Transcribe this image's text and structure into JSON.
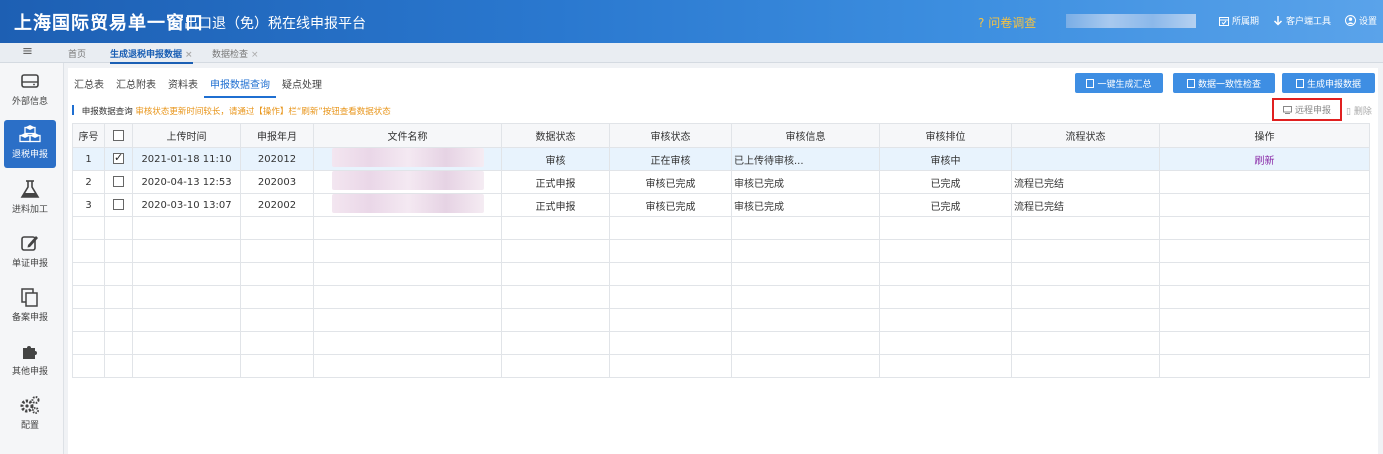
{
  "header": {
    "brand": "上海国际贸易单一窗口",
    "subtitle": "出口退（免）税在线申报平台",
    "survey": "问卷调查",
    "actions": [
      {
        "label": "所属期",
        "icon": "calendar-icon"
      },
      {
        "label": "客户端工具",
        "icon": "download-icon"
      },
      {
        "label": "设置",
        "icon": "user-icon"
      }
    ]
  },
  "page_tabs": [
    {
      "label": "首页"
    },
    {
      "label": "生成退税申报数据"
    },
    {
      "label": "数据检查"
    }
  ],
  "sidebar": {
    "items": [
      {
        "label": "外部信息",
        "icon": "hdd-icon"
      },
      {
        "label": "退税申报",
        "icon": "cubes-icon"
      },
      {
        "label": "进料加工",
        "icon": "flask-icon"
      },
      {
        "label": "单证申报",
        "icon": "edit-icon"
      },
      {
        "label": "备案申报",
        "icon": "copy-icon"
      },
      {
        "label": "其他申报",
        "icon": "puzzle-icon"
      },
      {
        "label": "配置",
        "icon": "gears-icon"
      }
    ]
  },
  "subtabs": [
    "汇总表",
    "汇总附表",
    "资料表",
    "申报数据查询",
    "疑点处理"
  ],
  "toolbar": {
    "btn_summary": "一键生成汇总",
    "btn_check": "数据一致性检查",
    "btn_generate": "生成申报数据",
    "remote": "远程申报",
    "delete": "删除"
  },
  "notice": {
    "label": "申报数据查询",
    "warning": "审核状态更新时间较长，请通过【操作】栏“刷新”按钮查看数据状态"
  },
  "table": {
    "headers": [
      "序号",
      "",
      "上传时间",
      "申报年月",
      "文件名称",
      "数据状态",
      "审核状态",
      "审核信息",
      "审核排位",
      "流程状态",
      "操作"
    ],
    "rows": [
      {
        "no": "1",
        "checked": true,
        "time": "2021-01-18 11:10",
        "period": "202012",
        "data_status": "审核",
        "audit_status": "正在审核",
        "audit_info": "已上传待审核...",
        "rank": "审核中",
        "flow": "",
        "op": "刷新"
      },
      {
        "no": "2",
        "checked": false,
        "time": "2020-04-13 12:53",
        "period": "202003",
        "data_status": "正式申报",
        "audit_status": "审核已完成",
        "audit_info": "审核已完成",
        "rank": "已完成",
        "flow": "流程已完结",
        "op": ""
      },
      {
        "no": "3",
        "checked": false,
        "time": "2020-03-10 13:07",
        "period": "202002",
        "data_status": "正式申报",
        "audit_status": "审核已完成",
        "audit_info": "审核已完成",
        "rank": "已完成",
        "flow": "流程已完结",
        "op": ""
      }
    ]
  },
  "colors": {
    "brand": "#1d5fb3",
    "accent": "#3e8ee3",
    "warning": "#e8951a",
    "highlight": "#e02020"
  }
}
